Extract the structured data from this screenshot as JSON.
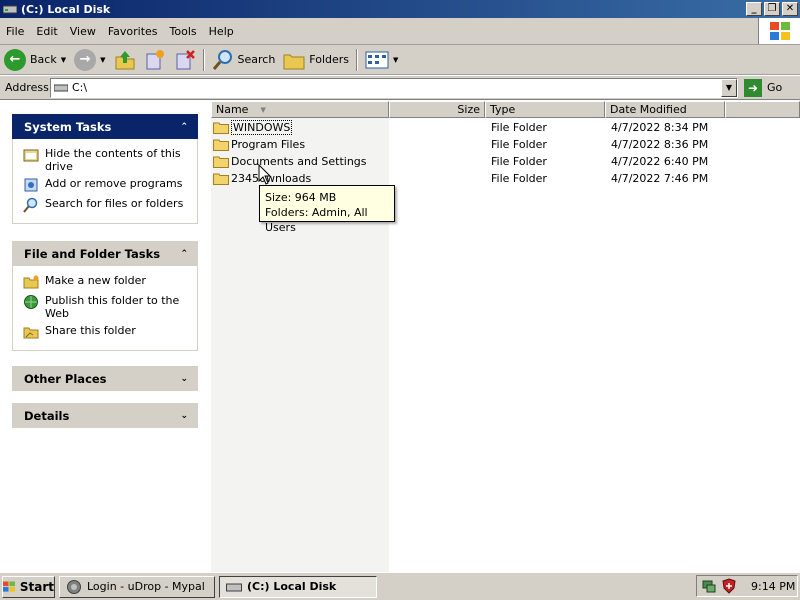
{
  "window": {
    "title": "(C:) Local Disk"
  },
  "menu": [
    "File",
    "Edit",
    "View",
    "Favorites",
    "Tools",
    "Help"
  ],
  "toolbar": {
    "back_label": "Back",
    "search_label": "Search",
    "folders_label": "Folders"
  },
  "address": {
    "label": "Address",
    "value": "C:\\",
    "go_label": "Go"
  },
  "left_panel": {
    "system_tasks": {
      "title": "System Tasks",
      "items": [
        "Hide the contents of this drive",
        "Add or remove programs",
        "Search for files or folders"
      ]
    },
    "file_folder_tasks": {
      "title": "File and Folder Tasks",
      "items": [
        "Make a new folder",
        "Publish this folder to the Web",
        "Share this folder"
      ]
    },
    "other_places": {
      "title": "Other Places"
    },
    "details": {
      "title": "Details"
    }
  },
  "columns": {
    "name": "Name",
    "size": "Size",
    "type": "Type",
    "date": "Date Modified"
  },
  "files": [
    {
      "name": "WINDOWS",
      "type": "File Folder",
      "date": "4/7/2022 8:34 PM"
    },
    {
      "name": "Program Files",
      "type": "File Folder",
      "date": "4/7/2022 8:36 PM"
    },
    {
      "name": "Documents and Settings",
      "type": "File Folder",
      "date": "4/7/2022 6:40 PM"
    },
    {
      "name": "23450wnloads",
      "type": "File Folder",
      "date": "4/7/2022 7:46 PM"
    }
  ],
  "tooltip": {
    "line1": "Size: 964 MB",
    "line2": "Folders: Admin, All Users"
  },
  "taskbar": {
    "start_label": "Start",
    "items": [
      "Login - uDrop - Mypal",
      "(C:) Local Disk"
    ],
    "clock": "9:14 PM"
  },
  "colors": {
    "title_bar": "#0a246a",
    "task_header": "#0a246a",
    "chrome": "#d4d0c8"
  }
}
